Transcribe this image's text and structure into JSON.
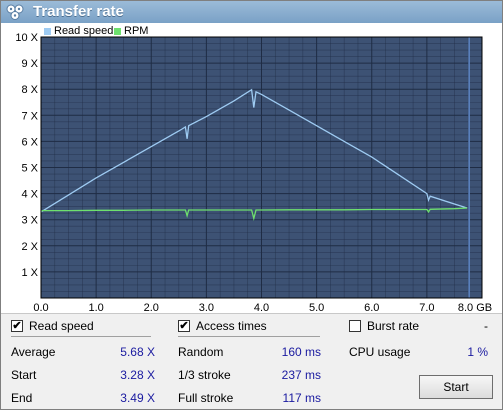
{
  "window": {
    "title": "Transfer rate"
  },
  "legend": {
    "read_speed": "Read speed",
    "rpm": "RPM"
  },
  "colors": {
    "read_speed": "#9ecbf2",
    "rpm": "#6ee06e",
    "plot_bg": "#3d5274",
    "grid": "#1f2c44",
    "value_text": "#1a1aa0"
  },
  "chart_data": {
    "type": "line",
    "x_ticks": [
      "0.0",
      "1.0",
      "2.0",
      "3.0",
      "4.0",
      "5.0",
      "6.0",
      "7.0",
      "8.0 GB"
    ],
    "y_ticks": [
      "1 X",
      "2 X",
      "3 X",
      "4 X",
      "5 X",
      "6 X",
      "7 X",
      "8 X",
      "9 X",
      "10 X"
    ],
    "xlim": [
      0,
      8.0
    ],
    "ylim": [
      0,
      10
    ],
    "grid": true,
    "legend_position": "top-left",
    "series": [
      {
        "name": "Read speed",
        "x": [
          0.0,
          0.5,
          1.0,
          1.5,
          2.0,
          2.5,
          2.62,
          2.65,
          2.68,
          3.0,
          3.5,
          3.82,
          3.86,
          3.9,
          4.0,
          4.5,
          5.0,
          5.5,
          6.0,
          6.5,
          7.0,
          7.03,
          7.06,
          7.5,
          7.73
        ],
        "y": [
          3.3,
          3.95,
          4.6,
          5.2,
          5.8,
          6.4,
          6.55,
          6.1,
          6.6,
          6.95,
          7.55,
          7.98,
          7.3,
          7.9,
          7.8,
          7.2,
          6.6,
          6.0,
          5.4,
          4.7,
          4.0,
          3.75,
          3.9,
          3.6,
          3.45
        ]
      },
      {
        "name": "RPM",
        "x": [
          0.0,
          0.5,
          1.0,
          1.5,
          2.0,
          2.5,
          2.62,
          2.65,
          2.68,
          3.0,
          3.5,
          3.82,
          3.86,
          3.9,
          4.0,
          4.5,
          5.0,
          5.5,
          6.0,
          6.5,
          7.0,
          7.03,
          7.06,
          7.5,
          7.73
        ],
        "y": [
          3.35,
          3.35,
          3.36,
          3.36,
          3.37,
          3.37,
          3.37,
          3.15,
          3.37,
          3.37,
          3.37,
          3.37,
          3.05,
          3.37,
          3.37,
          3.38,
          3.38,
          3.38,
          3.39,
          3.39,
          3.39,
          3.3,
          3.4,
          3.42,
          3.45
        ]
      }
    ]
  },
  "options": {
    "read_speed_label": "Read speed",
    "read_speed_check": "✔",
    "access_times_label": "Access times",
    "access_times_check": "✔",
    "burst_rate_label": "Burst rate",
    "burst_rate_value": "-"
  },
  "stats": {
    "average_label": "Average",
    "average_value": "5.68 X",
    "start_label": "Start",
    "start_value": "3.28 X",
    "end_label": "End",
    "end_value": "3.49 X",
    "random_label": "Random",
    "random_value": "160 ms",
    "third_stroke_label": "1/3 stroke",
    "third_stroke_value": "237 ms",
    "full_stroke_label": "Full stroke",
    "full_stroke_value": "117 ms",
    "cpu_usage_label": "CPU usage",
    "cpu_usage_value": "1 %"
  },
  "buttons": {
    "start_label": "Start"
  }
}
